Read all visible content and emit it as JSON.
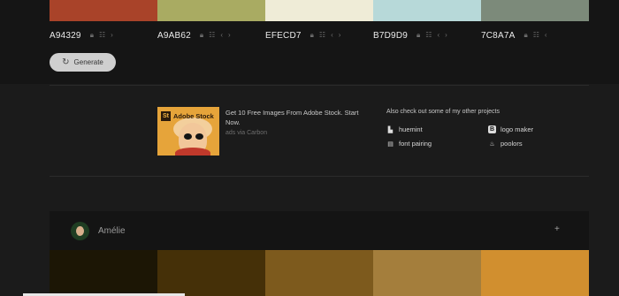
{
  "palette": {
    "colors": [
      {
        "hex": "A94329",
        "color": "#a94329"
      },
      {
        "hex": "A9AB62",
        "color": "#a9ab62"
      },
      {
        "hex": "EFECD7",
        "color": "#efecd7"
      },
      {
        "hex": "B7D9D9",
        "color": "#b7d9d9"
      },
      {
        "hex": "7C8A7A",
        "color": "#7c8a7a"
      }
    ],
    "generate_label": "Generate"
  },
  "ad": {
    "brand_logo": "Adobe Stock",
    "brand_badge": "St",
    "text": "Get 10 Free Images From Adobe Stock. Start Now.",
    "via": "ads via Carbon"
  },
  "projects": {
    "title": "Also check out some of my other projects",
    "items": [
      {
        "label": "huemint",
        "icon": "huemint-icon"
      },
      {
        "label": "logo maker",
        "icon": "logo-maker-icon"
      },
      {
        "label": "font pairing",
        "icon": "font-pairing-icon"
      },
      {
        "label": "poolors",
        "icon": "poolors-icon"
      }
    ]
  },
  "next_palette": {
    "name": "Amélie",
    "plus": "+",
    "colors": [
      "#1c1605",
      "#453008",
      "#7d5a1d",
      "#a47e3c",
      "#d18f2f"
    ]
  }
}
